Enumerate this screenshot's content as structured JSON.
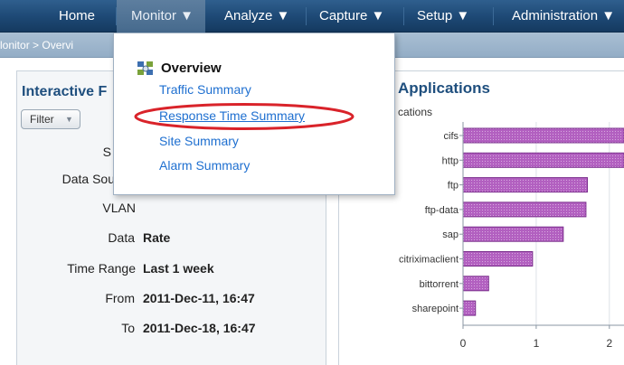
{
  "nav": {
    "items": [
      "Home",
      "Monitor ▼",
      "Analyze ▼",
      "Capture ▼",
      "Setup ▼",
      "Administration ▼"
    ]
  },
  "breadcrumb": {
    "text": "lonitor > Overvi"
  },
  "left_panel": {
    "title": "Interactive F",
    "filter_label": "Filter",
    "fields": [
      {
        "label": "S",
        "value": ""
      },
      {
        "label": "Data Sou",
        "value": ""
      },
      {
        "label": "VLAN",
        "value": ""
      },
      {
        "label": "Data",
        "value": "Rate"
      },
      {
        "label": "Time Range",
        "value": "Last 1 week"
      },
      {
        "label": "From",
        "value": "2011-Dec-11, 16:47"
      },
      {
        "label": "To",
        "value": "2011-Dec-18, 16:47"
      }
    ]
  },
  "right_panel": {
    "title": "Applications",
    "subtitle": "cations"
  },
  "dropdown": {
    "header": "Overview",
    "items": [
      "Traffic Summary",
      "Response Time Summary",
      "Site Summary",
      "Alarm Summary"
    ],
    "icon": "overview-grid-icon",
    "highlight_color": "#d9232a"
  },
  "chart_data": {
    "type": "bar",
    "orientation": "horizontal",
    "categories": [
      "cifs",
      "http",
      "ftp",
      "ftp-data",
      "sap",
      "citriximaclient",
      "bittorrent",
      "sharepoint"
    ],
    "values": [
      2.35,
      2.3,
      1.7,
      1.68,
      1.37,
      0.95,
      0.35,
      0.17
    ],
    "xticks": [
      0,
      1,
      2
    ],
    "xlim": [
      0,
      2.2
    ],
    "bar_color": "#b260c0",
    "grid": true
  }
}
